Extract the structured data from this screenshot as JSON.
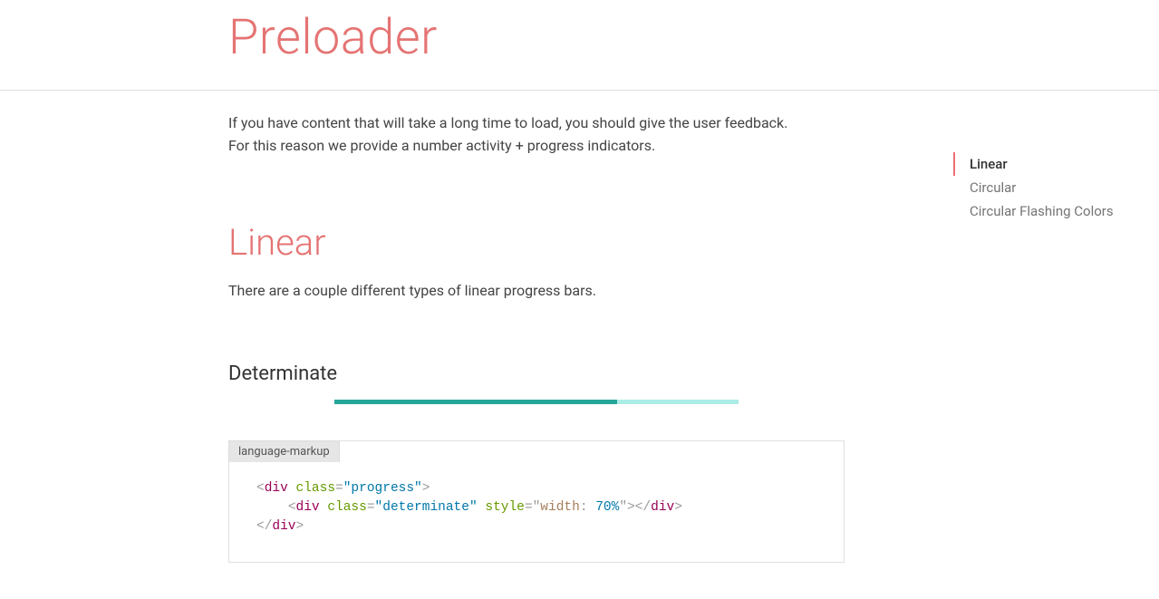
{
  "page_title": "Preloader",
  "caption": "If you have content that will take a long time to load, you should give the user feedback. For this reason we provide a number activity + progress indicators.",
  "section_linear": {
    "title": "Linear",
    "desc": "There are a couple different types of linear progress bars."
  },
  "determinate": {
    "title": "Determinate",
    "code_lang": "language-markup",
    "code_tokens": [
      {
        "t": "<",
        "c": "tok-punct"
      },
      {
        "t": "div",
        "c": "tok-tag"
      },
      {
        "t": " "
      },
      {
        "t": "class",
        "c": "tok-attr"
      },
      {
        "t": "=",
        "c": "tok-punct"
      },
      {
        "t": "\"progress\"",
        "c": "tok-val"
      },
      {
        "t": ">",
        "c": "tok-punct"
      },
      {
        "t": "\n    "
      },
      {
        "t": "<",
        "c": "tok-punct"
      },
      {
        "t": "div",
        "c": "tok-tag"
      },
      {
        "t": " "
      },
      {
        "t": "class",
        "c": "tok-attr"
      },
      {
        "t": "=",
        "c": "tok-punct"
      },
      {
        "t": "\"determinate\"",
        "c": "tok-val"
      },
      {
        "t": " "
      },
      {
        "t": "style",
        "c": "tok-attr"
      },
      {
        "t": "=",
        "c": "tok-punct"
      },
      {
        "t": "\"",
        "c": "tok-punct"
      },
      {
        "t": "width",
        "c": "tok-style"
      },
      {
        "t": ":",
        "c": "tok-punct"
      },
      {
        "t": " 70%",
        "c": "tok-val"
      },
      {
        "t": "\"",
        "c": "tok-punct"
      },
      {
        "t": ">",
        "c": "tok-punct"
      },
      {
        "t": "</",
        "c": "tok-punct"
      },
      {
        "t": "div",
        "c": "tok-tag"
      },
      {
        "t": ">",
        "c": "tok-punct"
      },
      {
        "t": "\n"
      },
      {
        "t": "</",
        "c": "tok-punct"
      },
      {
        "t": "div",
        "c": "tok-tag"
      },
      {
        "t": ">",
        "c": "tok-punct"
      }
    ]
  },
  "toc": {
    "items": [
      {
        "label": "Linear",
        "active": true
      },
      {
        "label": "Circular",
        "active": false
      },
      {
        "label": "Circular Flashing Colors",
        "active": false
      }
    ]
  }
}
